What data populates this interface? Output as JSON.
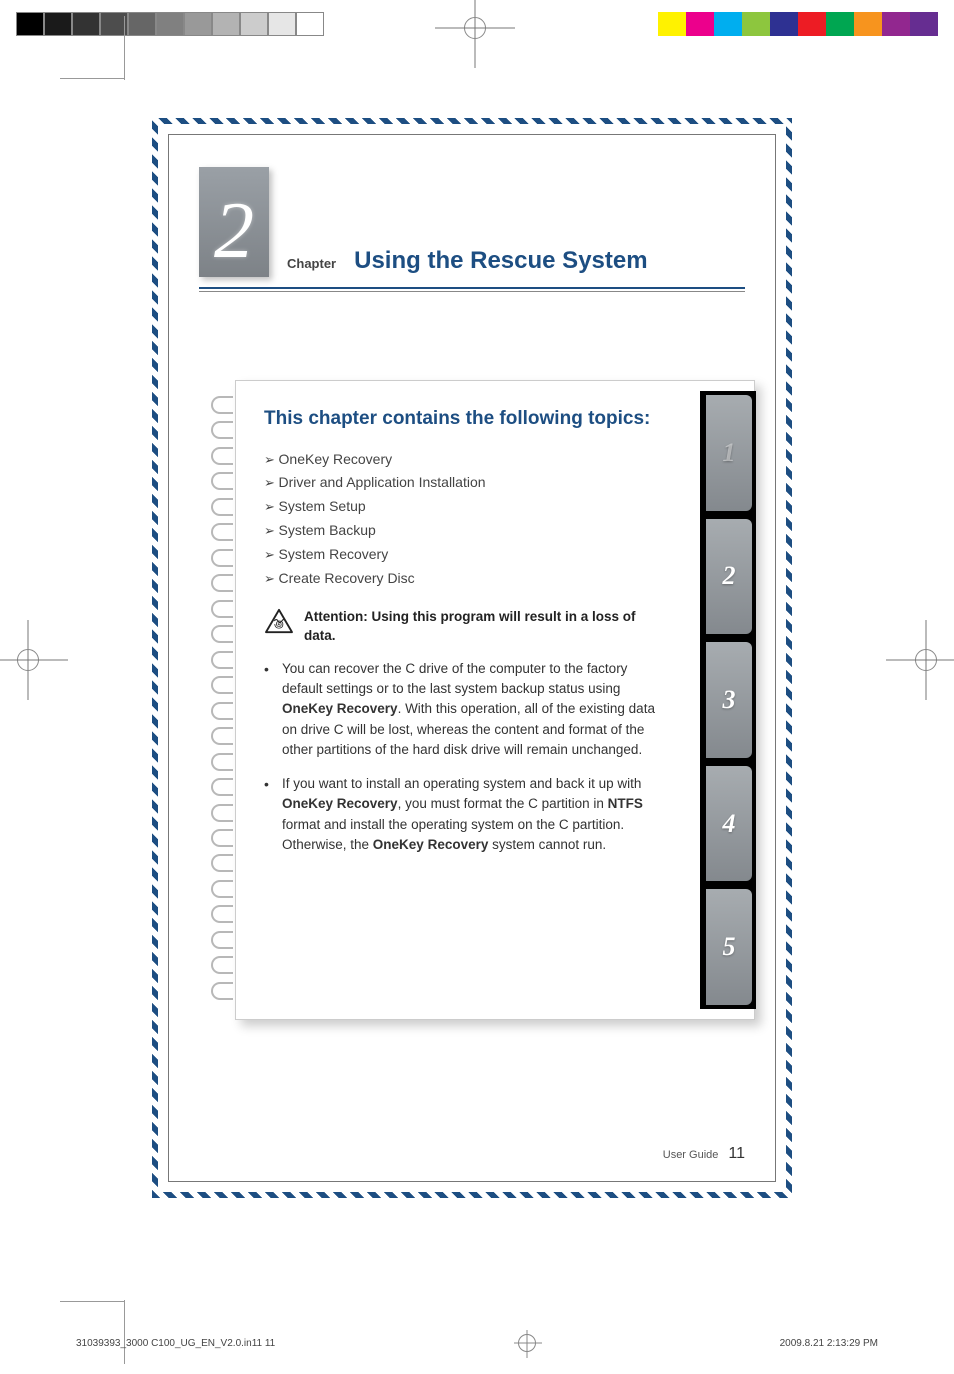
{
  "registration": {
    "greys": [
      "#000",
      "#1a1a1a",
      "#333",
      "#4d4d4d",
      "#666",
      "#808080",
      "#999",
      "#b3b3b3",
      "#ccc",
      "#e6e6e6",
      "#fff"
    ],
    "colors": [
      "#fff200",
      "#ec008c",
      "#00aeef",
      "#8dc63e",
      "#2e3192",
      "#ed1c24",
      "#00a651",
      "#f7941e",
      "#92278f",
      "#662d91"
    ]
  },
  "chapter": {
    "number": "2",
    "label": "Chapter",
    "title": "Using the Rescue System"
  },
  "card": {
    "heading": "This chapter contains the following topics:",
    "topics": [
      "OneKey Recovery",
      "Driver and Application Installation",
      "System Setup",
      "System Backup",
      "System Recovery",
      "Create Recovery Disc"
    ],
    "attention": "Attention: Using this program will result in a loss of data.",
    "bullets": [
      {
        "pre": "You can recover the C drive of the computer to the factory default settings or to the last system backup status using ",
        "b1": "OneKey Recovery",
        "mid": ". With this operation, all of the existing data on drive C will be lost, whereas the content and format of the other partitions of the hard disk drive will remain unchanged.",
        "b2": "",
        "mid2": "",
        "b3": "",
        "tail": ""
      },
      {
        "pre": "If you want to install an operating system and back it up with ",
        "b1": "OneKey Recovery",
        "mid": ", you must format the C partition in ",
        "b2": "NTFS",
        "mid2": " format and install the operating system on the C partition. Otherwise, the ",
        "b3": "OneKey Recovery",
        "tail": " system cannot run."
      }
    ],
    "tabs": [
      "1",
      "2",
      "3",
      "4",
      "5"
    ],
    "activeTab": 1
  },
  "footer": {
    "label": "User Guide",
    "page": "11"
  },
  "printFooter": {
    "left": "31039393_3000 C100_UG_EN_V2.0.in11   11",
    "right": "2009.8.21   2:13:29 PM"
  }
}
